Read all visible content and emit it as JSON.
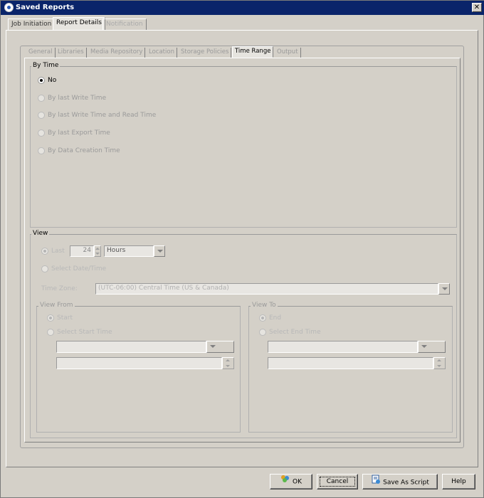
{
  "window": {
    "title": "Saved Reports",
    "close_glyph": "✕"
  },
  "top_tabs": [
    {
      "label": "Job Initiation",
      "state": "normal"
    },
    {
      "label": "Report Details",
      "state": "active"
    },
    {
      "label": "Notification",
      "state": "disabled"
    }
  ],
  "inner_tabs": [
    {
      "label": "General"
    },
    {
      "label": "Libraries"
    },
    {
      "label": "Media Repository"
    },
    {
      "label": "Location"
    },
    {
      "label": "Storage Policies"
    },
    {
      "label": "Time Range",
      "active": true
    },
    {
      "label": "Output"
    }
  ],
  "by_time": {
    "label": "By Time",
    "options": [
      {
        "label": "No",
        "selected": true,
        "enabled": true
      },
      {
        "label": "By last Write Time",
        "selected": false,
        "enabled": false
      },
      {
        "label": "By last Write Time and Read Time",
        "selected": false,
        "enabled": false
      },
      {
        "label": "By last Export Time",
        "selected": false,
        "enabled": false
      },
      {
        "label": "By Data Creation Time",
        "selected": false,
        "enabled": false
      }
    ]
  },
  "view": {
    "label": "View",
    "last_label": "Last",
    "last_value": "24",
    "unit_value": "Hours",
    "select_datetime_label": "Select Date/Time",
    "timezone_label": "Time Zone:",
    "timezone_value": "(UTC-06:00) Central Time (US & Canada)",
    "view_from": {
      "label": "View From",
      "start_label": "Start",
      "select_label": "Select Start Time"
    },
    "view_to": {
      "label": "View To",
      "end_label": "End",
      "select_label": "Select End Time"
    }
  },
  "buttons": {
    "ok": "OK",
    "cancel": "Cancel",
    "save_script": "Save As Script",
    "help": "Help"
  },
  "icons": {
    "ok": "users-ok-icon",
    "save_script": "script-save-icon",
    "app": "app-icon"
  }
}
